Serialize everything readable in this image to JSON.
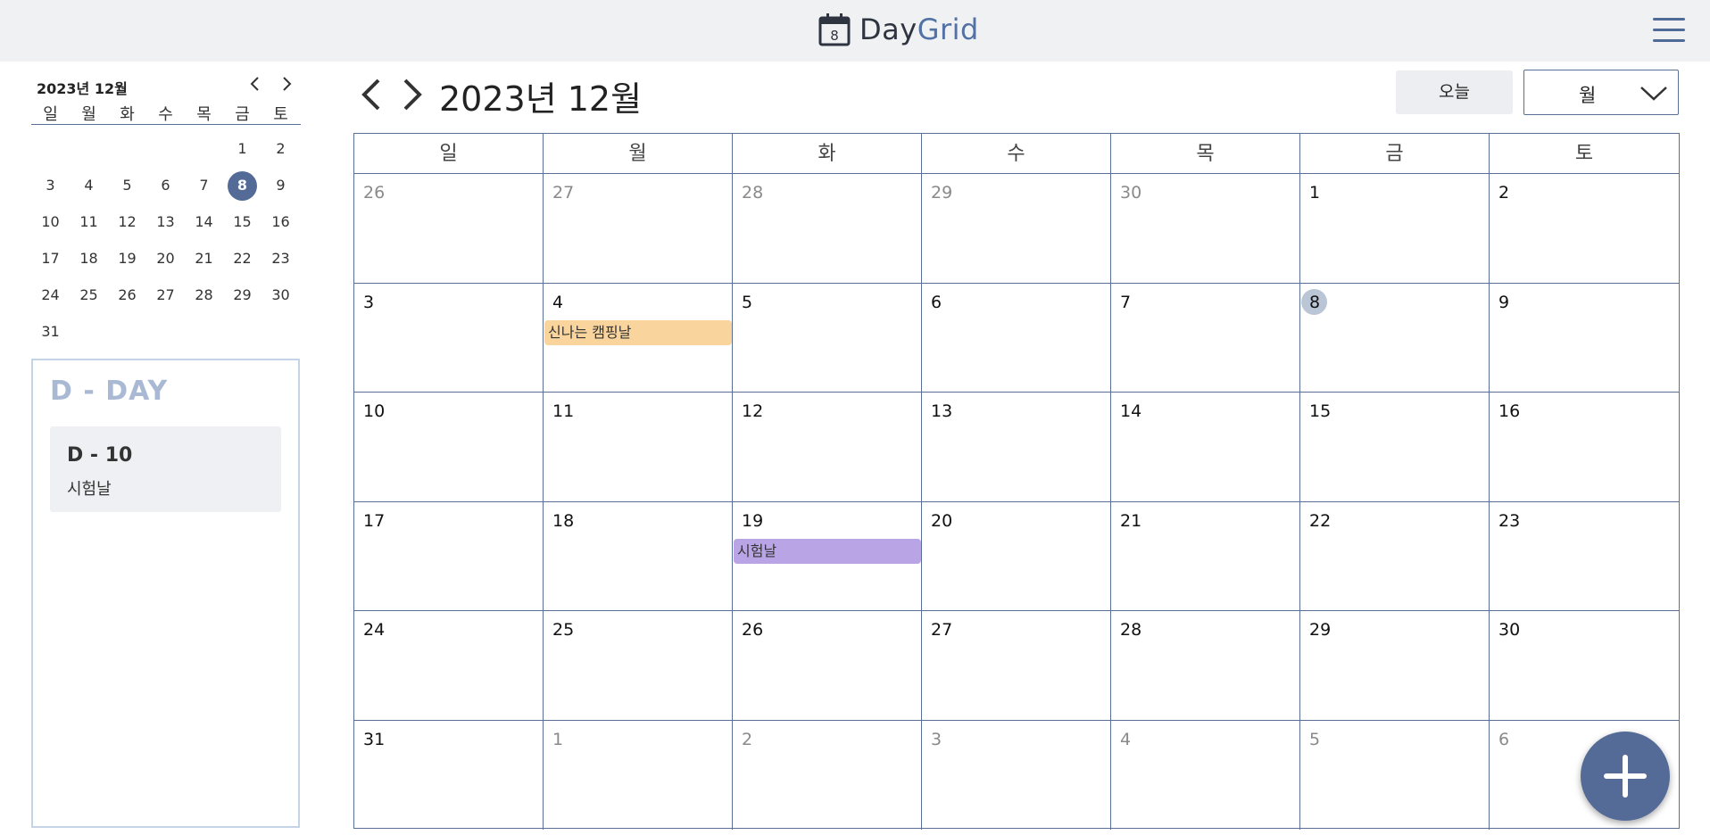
{
  "header": {
    "brand_part1": "Day",
    "brand_part2": "Grid",
    "brand_icon_day": "8",
    "icons": {
      "brand": "calendar-icon",
      "menu": "hamburger-menu-icon"
    }
  },
  "mini_calendar": {
    "title": "2023년 12월",
    "prev_icon": "chevron-left-icon",
    "next_icon": "chevron-right-icon",
    "weekdays": [
      "일",
      "월",
      "화",
      "수",
      "목",
      "금",
      "토"
    ],
    "days": [
      "",
      "",
      "",
      "",
      "",
      "1",
      "2",
      "3",
      "4",
      "5",
      "6",
      "7",
      "8",
      "9",
      "10",
      "11",
      "12",
      "13",
      "14",
      "15",
      "16",
      "17",
      "18",
      "19",
      "20",
      "21",
      "22",
      "23",
      "24",
      "25",
      "26",
      "27",
      "28",
      "29",
      "30",
      "31"
    ],
    "selected_day": "8"
  },
  "dday": {
    "title": "D - DAY",
    "items": [
      {
        "count": "D - 10",
        "name": "시험날"
      }
    ]
  },
  "toolbar": {
    "title": "2023년 12월",
    "prev_icon": "chevron-left-icon",
    "next_icon": "chevron-right-icon",
    "today_label": "오늘",
    "view_label": "월",
    "view_icon": "chevron-down-icon"
  },
  "calendar": {
    "weekdays": [
      "일",
      "월",
      "화",
      "수",
      "목",
      "금",
      "토"
    ],
    "weeks": [
      [
        {
          "d": "26",
          "other": true
        },
        {
          "d": "27",
          "other": true
        },
        {
          "d": "28",
          "other": true
        },
        {
          "d": "29",
          "other": true
        },
        {
          "d": "30",
          "other": true
        },
        {
          "d": "1"
        },
        {
          "d": "2"
        }
      ],
      [
        {
          "d": "3"
        },
        {
          "d": "4"
        },
        {
          "d": "5"
        },
        {
          "d": "6"
        },
        {
          "d": "7"
        },
        {
          "d": "8",
          "today": true
        },
        {
          "d": "9"
        }
      ],
      [
        {
          "d": "10"
        },
        {
          "d": "11"
        },
        {
          "d": "12"
        },
        {
          "d": "13"
        },
        {
          "d": "14"
        },
        {
          "d": "15"
        },
        {
          "d": "16"
        }
      ],
      [
        {
          "d": "17"
        },
        {
          "d": "18"
        },
        {
          "d": "19"
        },
        {
          "d": "20"
        },
        {
          "d": "21"
        },
        {
          "d": "22"
        },
        {
          "d": "23"
        }
      ],
      [
        {
          "d": "24"
        },
        {
          "d": "25"
        },
        {
          "d": "26"
        },
        {
          "d": "27"
        },
        {
          "d": "28"
        },
        {
          "d": "29"
        },
        {
          "d": "30"
        }
      ],
      [
        {
          "d": "31"
        },
        {
          "d": "1",
          "other": true
        },
        {
          "d": "2",
          "other": true
        },
        {
          "d": "3",
          "other": true
        },
        {
          "d": "4",
          "other": true
        },
        {
          "d": "5",
          "other": true
        },
        {
          "d": "6",
          "other": true
        }
      ]
    ],
    "events": [
      {
        "title": "신나는 캠핑날",
        "date": "2023-12-04",
        "color": "#f9d49d"
      },
      {
        "title": "시험날",
        "date": "2023-12-19",
        "color": "#b9a5e6"
      }
    ]
  },
  "fab": {
    "icon": "plus-icon"
  },
  "colors": {
    "accent": "#546a97",
    "header_bg": "#f0f1f3",
    "grid_line": "#5a6f95",
    "dday_title": "#a9b9d4"
  }
}
